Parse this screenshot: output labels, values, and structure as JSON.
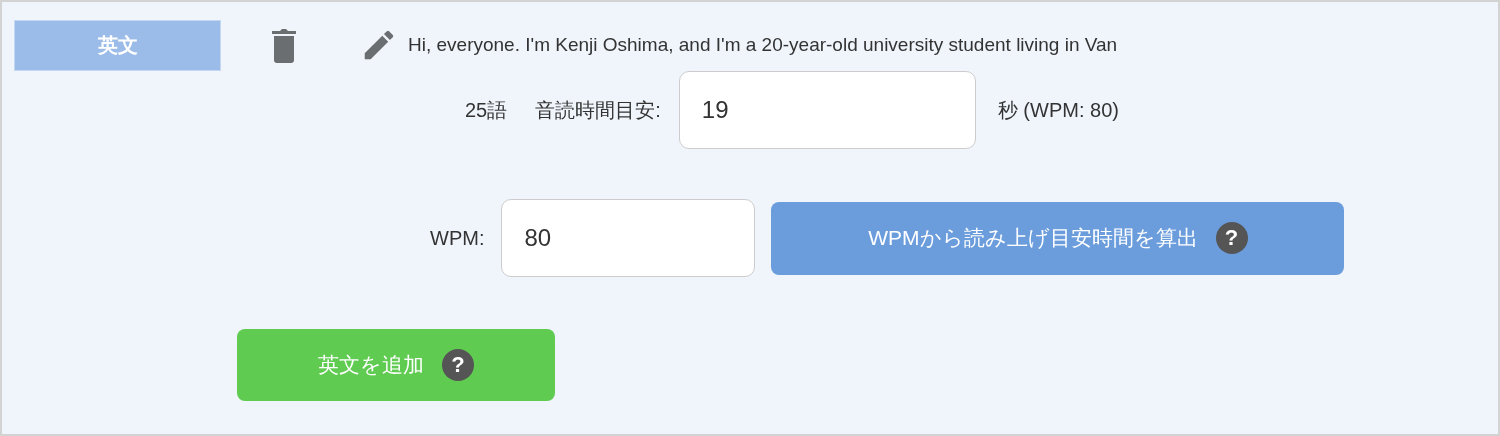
{
  "sentence_row": {
    "tag": "英文",
    "text": "Hi, everyone. I'm Kenji Oshima, and I'm a 20-year-old university student living in Van"
  },
  "timing": {
    "word_count": "25語",
    "time_label": "音読時間目安:",
    "time_value": "19",
    "time_unit": "秒 (WPM: 80)"
  },
  "wpm": {
    "label": "WPM:",
    "value": "80",
    "calc_button": {
      "label": "WPMから読み上げ目安時間を算出",
      "help": "?"
    }
  },
  "add_button": {
    "label": "英文を追加",
    "help": "?"
  }
}
